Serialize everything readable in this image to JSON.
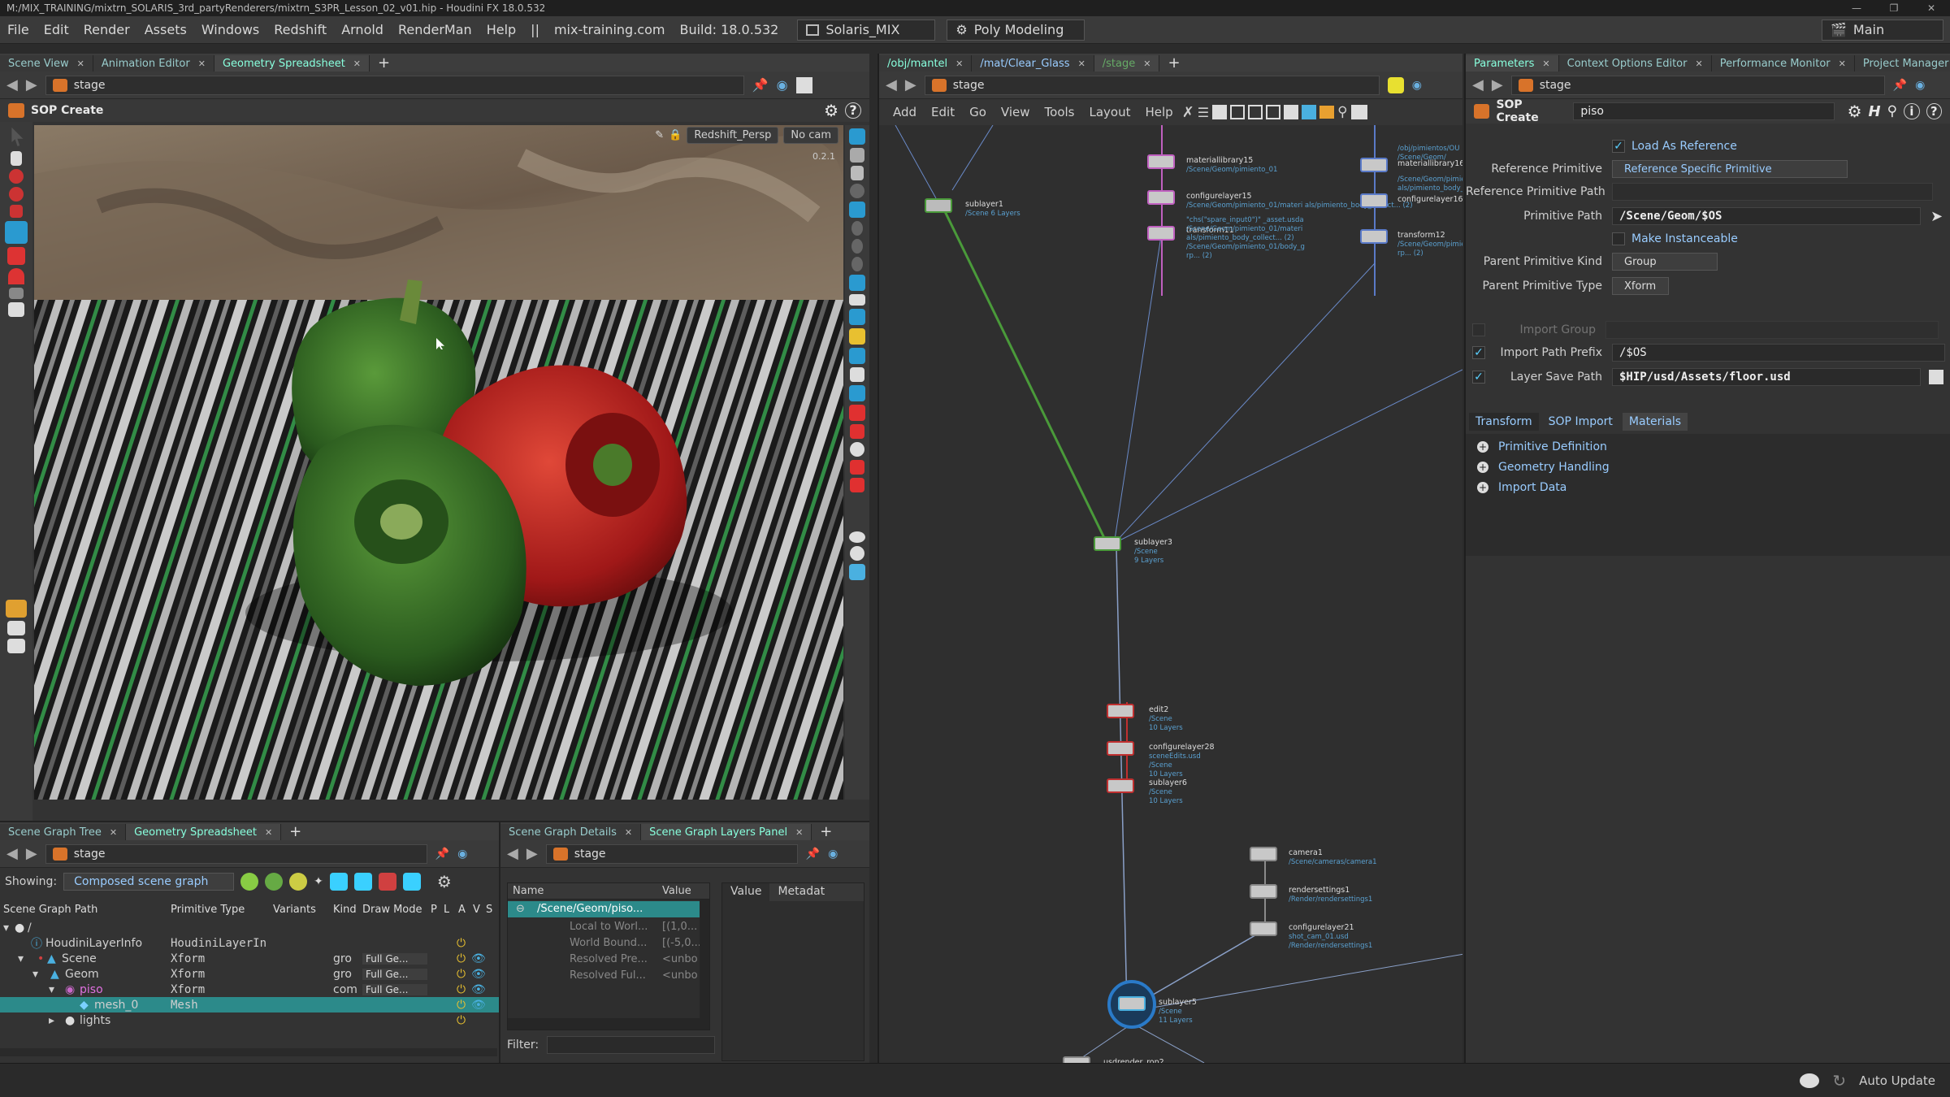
{
  "titlebar": {
    "text": "M:/MIX_TRAINING/mixtrn_SOLARIS_3rd_partyRenderers/mixtrn_S3PR_Lesson_02_v01.hip - Houdini FX 18.0.532"
  },
  "menubar": {
    "items": [
      "File",
      "Edit",
      "Render",
      "Assets",
      "Windows",
      "Redshift",
      "Arnold",
      "RenderMan",
      "Help"
    ],
    "sep": "||",
    "site": "mix-training.com",
    "build": "Build: 18.0.532",
    "desktop": "Solaris_MIX",
    "shelf_set": "Poly Modeling",
    "main": "Main"
  },
  "viewport": {
    "tabs": [
      "Scene View",
      "Animation Editor",
      "Geometry Spreadsheet"
    ],
    "path": "stage",
    "header": "SOP Create",
    "camera_menu": "Redshift_Persp",
    "cam_menu2": "No cam",
    "frame_label": "0.2.1"
  },
  "left_bottom": {
    "tabs": [
      "Scene Graph Tree",
      "Geometry Spreadsheet"
    ],
    "path": "stage",
    "showing_label": "Showing:",
    "showing_value": "Composed scene graph",
    "columns": [
      "Scene Graph Path",
      "Primitive Type",
      "Variants",
      "Kind",
      "Draw Mode",
      "P",
      "L",
      "A",
      "V",
      "S"
    ],
    "rows": [
      {
        "name": "/",
        "type": "",
        "kind": "",
        "draw": "",
        "indent": 0
      },
      {
        "name": "HoudiniLayerInfo",
        "type": "HoudiniLayerIn",
        "kind": "",
        "draw": "",
        "indent": 1
      },
      {
        "name": "Scene",
        "type": "Xform",
        "kind": "gro",
        "draw": "Full Ge...",
        "indent": 1
      },
      {
        "name": "Geom",
        "type": "Xform",
        "kind": "gro",
        "draw": "Full Ge...",
        "indent": 2
      },
      {
        "name": "piso",
        "type": "Xform",
        "kind": "com",
        "draw": "Full Ge...",
        "indent": 3
      },
      {
        "name": "mesh_0",
        "type": "Mesh",
        "kind": "",
        "draw": "",
        "indent": 4
      },
      {
        "name": "lights",
        "type": "",
        "kind": "",
        "draw": "",
        "indent": 2
      }
    ]
  },
  "mid_bottom": {
    "tabs": [
      "Scene Graph Details",
      "Scene Graph Layers Panel"
    ],
    "path": "stage",
    "name_col": "Name",
    "value_col": "Value",
    "value_tab": "Value",
    "metadata_tab": "Metadat",
    "rows": [
      {
        "name": "/Scene/Geom/piso...",
        "value": ""
      },
      {
        "name": "Local to Worl...",
        "value": "[(1,0..."
      },
      {
        "name": "World Bound...",
        "value": "[(-5,0..."
      },
      {
        "name": "Resolved Pre...",
        "value": "<unbo"
      },
      {
        "name": "Resolved Ful...",
        "value": "<unbo"
      }
    ],
    "filter_label": "Filter:"
  },
  "network": {
    "tabs": [
      "/obj/mantel",
      "/mat/Clear_Glass",
      "/stage"
    ],
    "path": "stage",
    "menu": [
      "Add",
      "Edit",
      "Go",
      "View",
      "Tools",
      "Layout",
      "Help"
    ],
    "nodes": [
      {
        "name": "sublayer1",
        "sub": "/Scene\n6 Layers"
      },
      {
        "name": "materiallibrary15",
        "sub": "/Scene/Geom/pimiento_01"
      },
      {
        "name": "configurelayer15",
        "sub": "/Scene/Geom/pimiento_01/materi\nals/pimiento_body_collect... (2)"
      },
      {
        "name": "transform11",
        "sub": "\"chs(\"spare_input0\")\" _asset.usda\n/Scene/Geom/pimiento_01/materi\nals/pimiento_body_collect... (2)\n/Scene/Geom/pimiento_01/body_g\nrp... (2)"
      },
      {
        "name": "materiallibrary16",
        "sub": "/obj/pimientos/OU\n/Scene/Geom/"
      },
      {
        "name": "configurelayer16",
        "sub": "/Scene/Geom/pimie\nals/pimiento_body_"
      },
      {
        "name": "transform12",
        "sub": "/Scene/Geom/pimie\nrp... (2)"
      },
      {
        "name": "sublayer3",
        "sub": "/Scene\n9 Layers"
      },
      {
        "name": "edit2",
        "sub": "/Scene\n10 Layers"
      },
      {
        "name": "configurelayer28",
        "sub": "sceneEdits.usd\n/Scene\n10 Layers"
      },
      {
        "name": "sublayer6",
        "sub": "/Scene\n10 Layers"
      },
      {
        "name": "camera1",
        "sub": "/Scene/cameras/camera1"
      },
      {
        "name": "rendersettings1",
        "sub": "/Render/rendersettings1"
      },
      {
        "name": "configurelayer21",
        "sub": "shot_cam_01.usd\n/Render/rendersettings1"
      },
      {
        "name": "sublayer5",
        "sub": "/Scene\n11 Layers"
      },
      {
        "name": "usdrender_rop2",
        "sub": ""
      }
    ]
  },
  "params": {
    "tabs": [
      "Parameters",
      "Context Options Editor",
      "Performance Monitor",
      "Project Manager"
    ],
    "path": "stage",
    "node_type": "SOP Create",
    "node_name": "piso",
    "load_as_reference": "Load As Reference",
    "ref_prim_label": "Reference Primitive",
    "ref_prim_value": "Reference Specific Primitive",
    "ref_prim_path_label": "Reference Primitive Path",
    "prim_path_label": "Primitive Path",
    "prim_path_value": "/Scene/Geom/$OS",
    "make_instanceable": "Make Instanceable",
    "parent_kind_label": "Parent Primitive Kind",
    "parent_kind_value": "Group",
    "parent_type_label": "Parent Primitive Type",
    "parent_type_value": "Xform",
    "import_group_label": "Import Group",
    "import_prefix_label": "Import Path Prefix",
    "import_prefix_value": "/$OS",
    "layer_save_label": "Layer Save Path",
    "layer_save_value": "$HIP/usd/Assets/floor.usd",
    "subtabs": [
      "Transform",
      "SOP Import",
      "Materials"
    ],
    "folders": [
      "Primitive Definition",
      "Geometry Handling",
      "Import Data"
    ]
  },
  "status": {
    "auto_update": "Auto Update"
  }
}
